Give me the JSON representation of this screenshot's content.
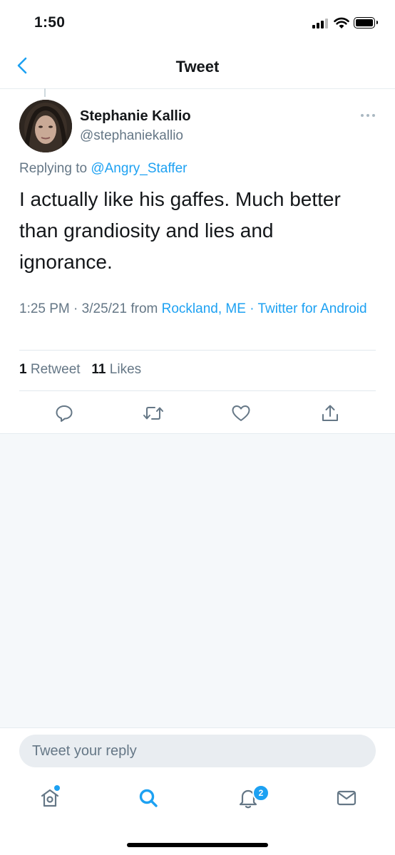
{
  "status_bar": {
    "time": "1:50"
  },
  "header": {
    "title": "Tweet"
  },
  "tweet": {
    "author_name": "Stephanie Kallio",
    "author_handle": "@stephaniekallio",
    "replying_prefix": "Replying to",
    "replying_to": "@Angry_Staffer",
    "text": "I actually like his gaffes. Much better than grandiosity and lies and ignorance.",
    "time": "1:25 PM",
    "sep1": "·",
    "date": "3/25/21",
    "from_label": "from",
    "location": "Rockland, ME",
    "sep2": "·",
    "source": "Twitter for Android",
    "retweet_count": "1",
    "retweet_label": "Retweet",
    "like_count": "11",
    "like_label": "Likes"
  },
  "reply": {
    "placeholder": "Tweet your reply"
  },
  "tabbar": {
    "notifications_badge": "2"
  },
  "colors": {
    "accent": "#1da1f2",
    "secondary_text": "#657786",
    "background_grey": "#f5f8fa"
  },
  "icons": [
    "back-chevron-icon",
    "more-icon",
    "reply-icon",
    "retweet-icon",
    "like-icon",
    "share-icon",
    "home-icon",
    "search-icon",
    "notifications-icon",
    "messages-icon"
  ]
}
